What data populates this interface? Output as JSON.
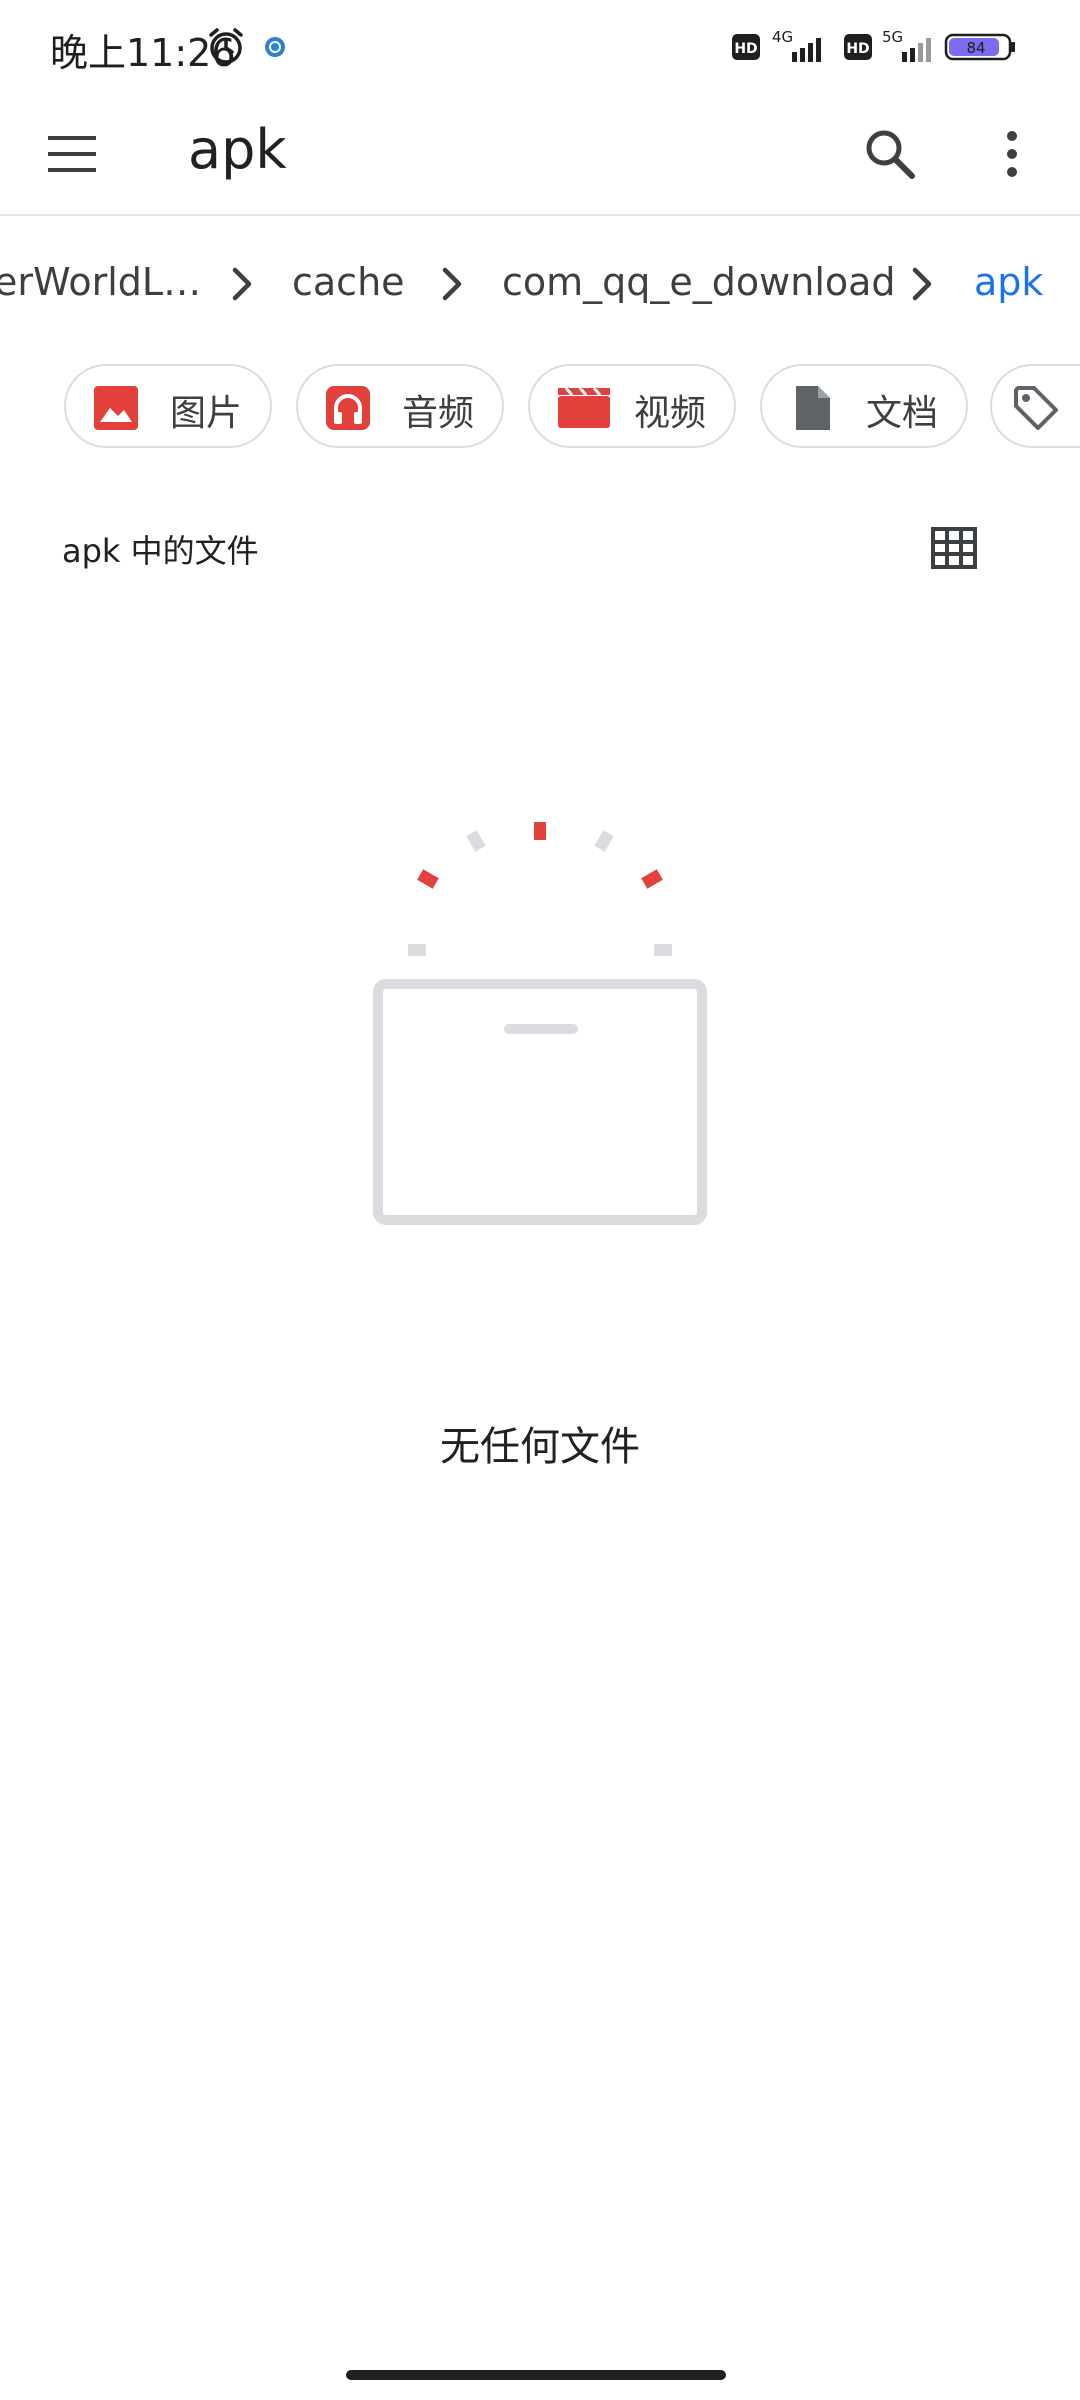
{
  "status_bar": {
    "time": "晚上11:26",
    "network_1": "4G",
    "network_2": "5G",
    "hd_label": "HD",
    "battery": "84"
  },
  "app_bar": {
    "title": "apk"
  },
  "breadcrumb": {
    "items": [
      {
        "label": "erWorldL…"
      },
      {
        "label": "cache"
      },
      {
        "label": "com_qq_e_download"
      },
      {
        "label": "apk"
      }
    ]
  },
  "chips": [
    {
      "label": "图片",
      "icon": "image-icon"
    },
    {
      "label": "音频",
      "icon": "headphones-icon"
    },
    {
      "label": "视频",
      "icon": "video-icon"
    },
    {
      "label": "文档",
      "icon": "document-icon"
    },
    {
      "label": "",
      "icon": "tag-icon"
    }
  ],
  "section": {
    "title": "apk 中的文件"
  },
  "empty_state": {
    "message": "无任何文件"
  },
  "colors": {
    "accent": "#1a73e8",
    "category_red": "#e2403b",
    "doc_gray": "#5f6368"
  }
}
